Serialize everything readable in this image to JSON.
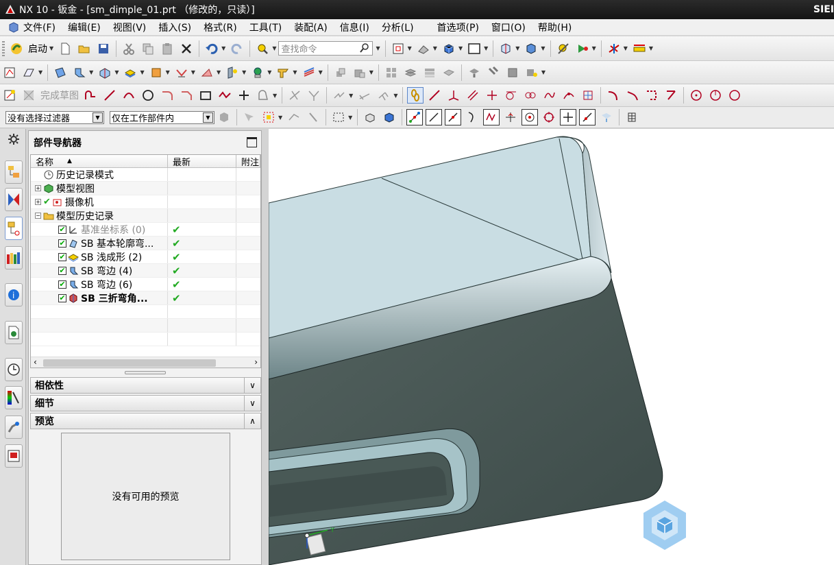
{
  "titlebar": {
    "title": "NX 10 - 钣金 - [sm_dimple_01.prt （修改的，只读）]",
    "brand": "SIEI"
  },
  "menu": [
    "文件(F)",
    "编辑(E)",
    "视图(V)",
    "插入(S)",
    "格式(R)",
    "工具(T)",
    "装配(A)",
    "信息(I)",
    "分析(L)",
    "首选项(P)",
    "窗口(O)",
    "帮助(H)"
  ],
  "toolbar": {
    "start_label": "启动",
    "search_placeholder": "查找命令",
    "sketch_label": "完成草图"
  },
  "selection": {
    "filter_value": "没有选择过滤器",
    "scope_value": "仅在工作部件内"
  },
  "navigator": {
    "title": "部件导航器",
    "columns": [
      "名称",
      "最新",
      "附注"
    ],
    "nodes": [
      {
        "label": "历史记录模式",
        "latest": ""
      },
      {
        "label": "模型视图",
        "latest": ""
      },
      {
        "label": "摄像机",
        "latest": ""
      },
      {
        "label": "模型历史记录",
        "latest": ""
      },
      {
        "label": "基准坐标系 (0)",
        "latest": "✔"
      },
      {
        "label": "SB 基本轮廓弯...",
        "latest": "✔"
      },
      {
        "label": "SB 浅成形 (2)",
        "latest": "✔"
      },
      {
        "label": "SB 弯边 (4)",
        "latest": "✔"
      },
      {
        "label": "SB 弯边 (6)",
        "latest": "✔"
      },
      {
        "label": "SB 三折弯角...",
        "latest": "✔"
      }
    ],
    "sections": {
      "dependencies": "相依性",
      "details": "细节",
      "preview": "预览"
    },
    "preview_text": "没有可用的预览"
  },
  "viewport": {
    "triad_y": "Y"
  },
  "colors": {
    "accent": "#1e6fd9",
    "model_top": "#c9dde3",
    "model_side": "#4a5a58"
  }
}
